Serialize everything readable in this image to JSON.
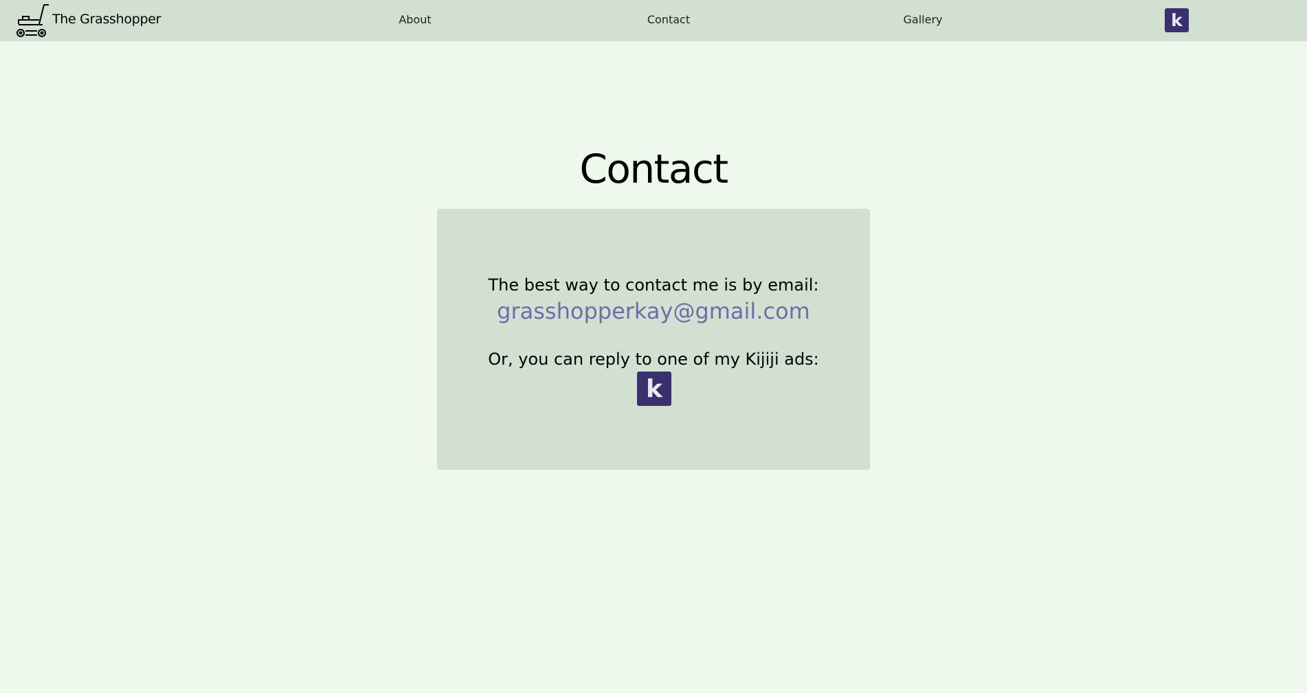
{
  "nav": {
    "brand": "The Grasshopper",
    "logo_icon": "lawn-mower-icon",
    "links": [
      {
        "label": "About"
      },
      {
        "label": "Contact"
      },
      {
        "label": "Gallery"
      }
    ],
    "kijiji_icon": {
      "name": "kijiji-icon",
      "letter": "k"
    }
  },
  "main": {
    "title": "Contact",
    "email_intro": "The best way to contact me is by email:",
    "email": "grasshopperkay@gmail.com",
    "kijiji_intro": "Or, you can reply to one of my Kijiji ads:",
    "kijiji_letter": "k"
  },
  "colors": {
    "background": "#eff8ed",
    "panel": "#d2e0d2",
    "link": "#6b6fa8",
    "kijiji": "#3a3070"
  }
}
